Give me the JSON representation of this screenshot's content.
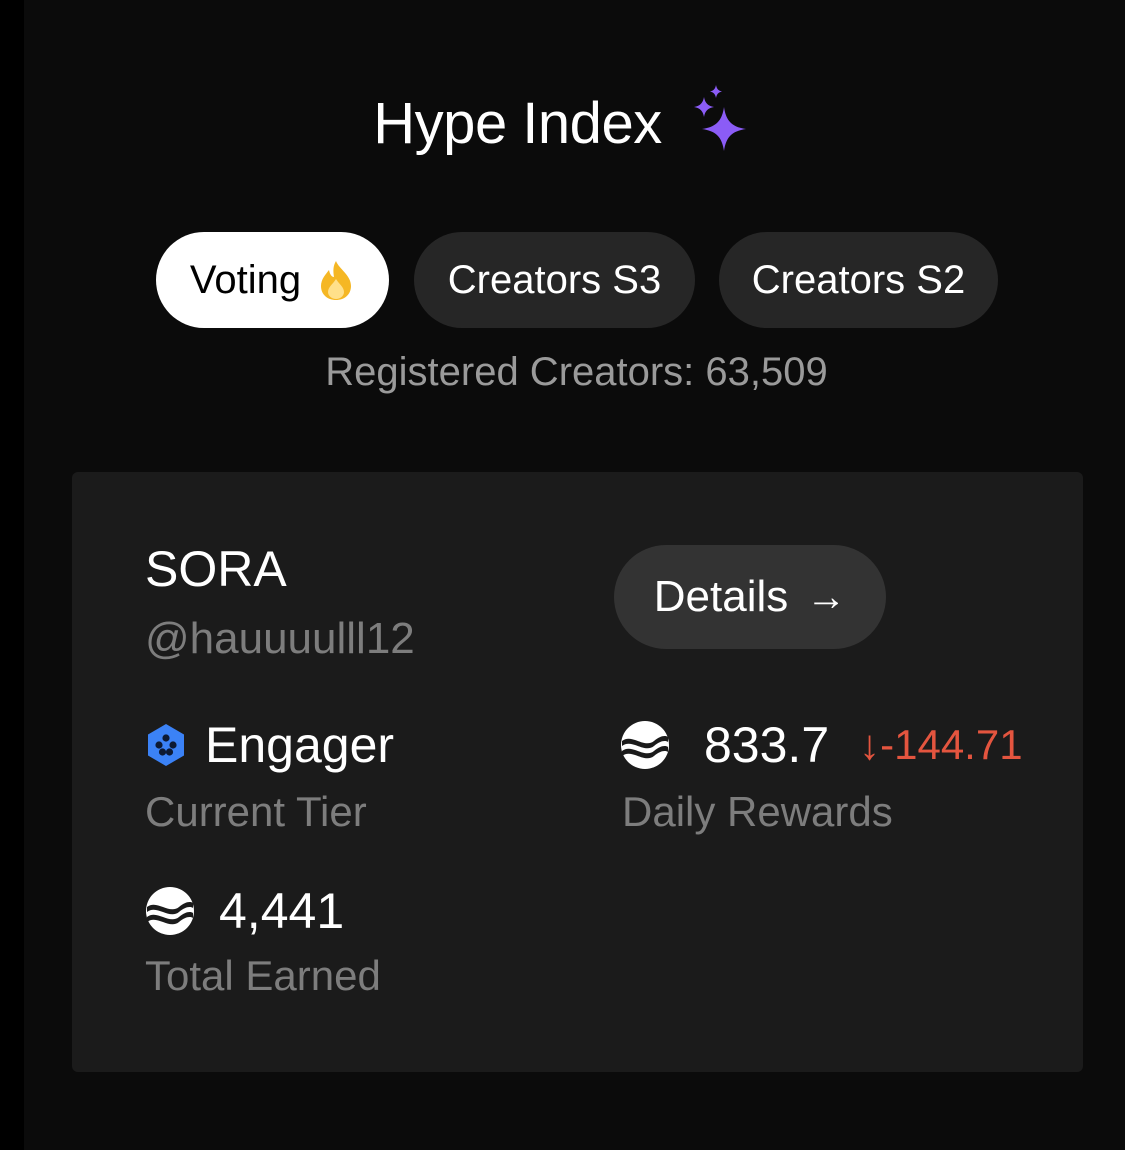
{
  "header": {
    "title": "Hype Index",
    "icon": "sparkles-icon",
    "sparkle_color": "#8B5CF6"
  },
  "tabs": [
    {
      "label": "Voting",
      "icon": "fire-icon",
      "selected": true
    },
    {
      "label": "Creators S3",
      "selected": false
    },
    {
      "label": "Creators S2",
      "selected": false
    }
  ],
  "registered_creators": "Registered Creators: 63,509",
  "card": {
    "name": "SORA",
    "handle": "@hauuuulll12",
    "details_button": {
      "label": "Details",
      "icon": "arrow-right-icon"
    },
    "tier": {
      "icon": "hexagon-tier-icon",
      "value": "Engager",
      "label": "Current Tier",
      "color": "#3B82F6"
    },
    "daily_rewards": {
      "icon": "coin-icon",
      "value": "833.7",
      "change": "↓-144.71",
      "change_color": "#E4553F",
      "label": "Daily Rewards"
    },
    "total_earned": {
      "icon": "coin-icon",
      "value": "4,441",
      "label": "Total Earned"
    }
  }
}
